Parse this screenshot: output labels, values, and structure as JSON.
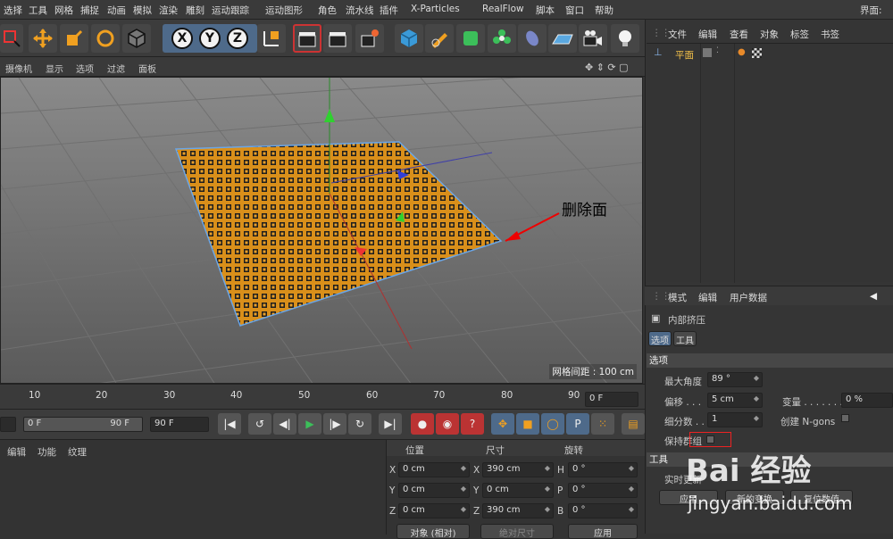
{
  "menu": {
    "items": [
      "选择",
      "工具",
      "网格",
      "捕捉",
      "动画",
      "模拟",
      "渲染",
      "雕刻",
      "运动跟踪",
      "运动图形",
      "角色",
      "流水线",
      "插件",
      "X-Particles",
      "RealFlow",
      "脚本",
      "窗口",
      "帮助"
    ],
    "layout_label": "界面:"
  },
  "axis_buttons": [
    "X",
    "Y",
    "Z"
  ],
  "viewport": {
    "menu": [
      "摄像机",
      "显示",
      "选项",
      "过滤",
      "面板"
    ],
    "grid_info": "网格间距 : 100 cm",
    "annotation": "删除面"
  },
  "objects": {
    "tabs": [
      "文件",
      "编辑",
      "查看",
      "对象",
      "标签",
      "书签"
    ],
    "items": [
      {
        "name": "平面"
      }
    ]
  },
  "attributes": {
    "tabs": [
      "模式",
      "编辑",
      "用户数据"
    ],
    "tool_name": "内部挤压",
    "subtabs": [
      "选项",
      "工具"
    ],
    "options_section": "选项",
    "max_angle_label": "最大角度",
    "max_angle": "89 °",
    "offset_label": "偏移 . . .",
    "offset": "5 cm",
    "variance_label": "变量 . . . . . . .",
    "variance": "0 %",
    "subdiv_label": "细分数 . .",
    "subdiv": "1",
    "ngons_label": "创建 N-gons",
    "keep_groups_label": "保持群组",
    "tool_section": "工具",
    "realtime_label": "实时更新",
    "btn_apply": "应用",
    "btn_new": "新的变换",
    "btn_reset": "复位数值"
  },
  "timeline": {
    "ticks": [
      "10",
      "20",
      "30",
      "40",
      "50",
      "60",
      "70",
      "80",
      "90"
    ],
    "frame_field": "0 F"
  },
  "transport": {
    "start": "0 F",
    "end": "90 F",
    "end2": "90 F"
  },
  "coords": {
    "tabs": [
      "编辑",
      "功能",
      "纹理"
    ],
    "headers": [
      "位置",
      "尺寸",
      "旋转"
    ],
    "rows": [
      {
        "a": "X",
        "pos": "0 cm",
        "b": "X",
        "size": "390 cm",
        "c": "H",
        "rot": "0 °"
      },
      {
        "a": "Y",
        "pos": "0 cm",
        "b": "Y",
        "size": "0 cm",
        "c": "P",
        "rot": "0 °"
      },
      {
        "a": "Z",
        "pos": "0 cm",
        "b": "Z",
        "size": "390 cm",
        "c": "B",
        "rot": "0 °"
      }
    ],
    "mode": "对象 (相对)",
    "size_mode": "绝对尺寸",
    "apply": "应用"
  },
  "watermark": {
    "brand": "Bai 经验",
    "url": "jingyan.baidu.com"
  }
}
